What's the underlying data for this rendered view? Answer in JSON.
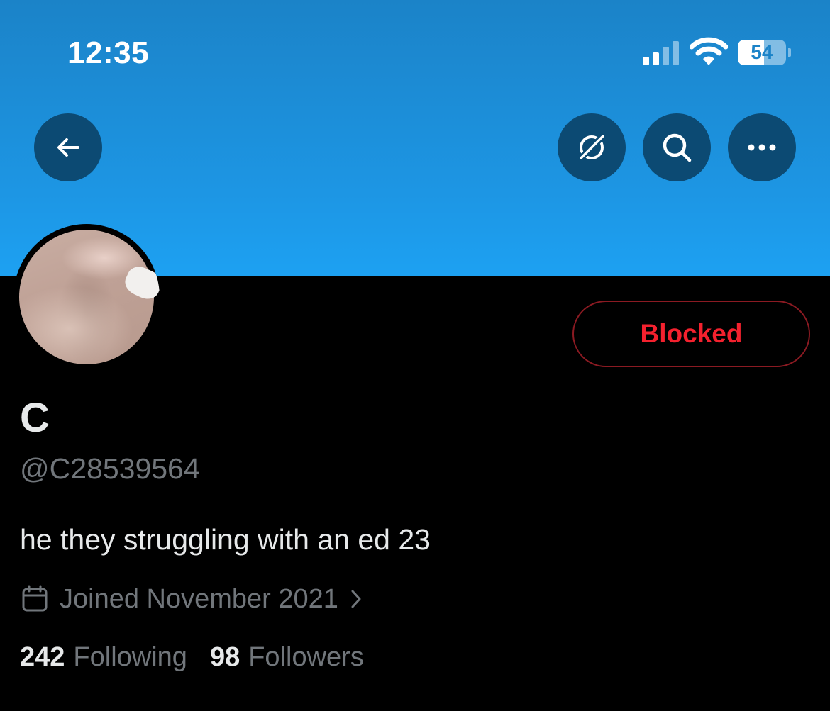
{
  "status_bar": {
    "time": "12:35",
    "battery_level": "54",
    "battery_fraction": 0.54,
    "icons": [
      "signal-icon",
      "wifi-icon",
      "battery-icon"
    ]
  },
  "header": {
    "banner_color": "#1d96e4",
    "buttons": [
      "back-arrow-icon",
      "grok-icon",
      "search-icon",
      "more-icon"
    ]
  },
  "profile": {
    "display_name": "C",
    "handle": "@C28539564",
    "bio": "he they struggling with an ed 23",
    "joined": "Joined November 2021",
    "blocked_label": "Blocked",
    "blocked_color": "#f4212e"
  },
  "stats": {
    "following_count": "242",
    "following_label": "Following",
    "followers_count": "98",
    "followers_label": "Followers"
  }
}
